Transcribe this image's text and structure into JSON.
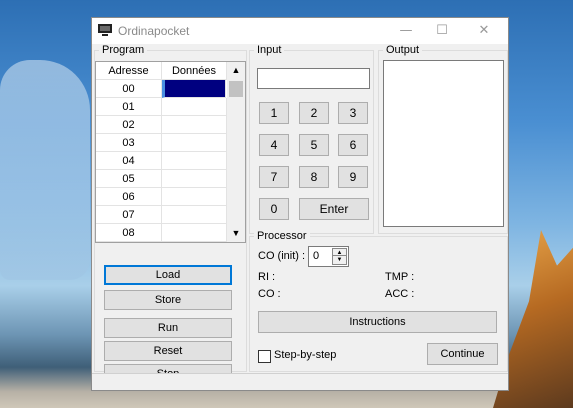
{
  "window": {
    "title": "Ordinapocket",
    "controls": {
      "minimize": "—",
      "maximize": "☐",
      "close": "✕"
    }
  },
  "program": {
    "title": "Program",
    "columns": [
      "Adresse",
      "Données"
    ],
    "rows": [
      {
        "addr": "00",
        "data": ""
      },
      {
        "addr": "01",
        "data": ""
      },
      {
        "addr": "02",
        "data": ""
      },
      {
        "addr": "03",
        "data": ""
      },
      {
        "addr": "04",
        "data": ""
      },
      {
        "addr": "05",
        "data": ""
      },
      {
        "addr": "06",
        "data": ""
      },
      {
        "addr": "07",
        "data": ""
      },
      {
        "addr": "08",
        "data": ""
      }
    ],
    "selected_color": "#000080"
  },
  "actions": {
    "load": "Load",
    "store": "Store",
    "run": "Run",
    "reset": "Reset",
    "stop": "Stop"
  },
  "input": {
    "title": "Input",
    "value": "",
    "keys": [
      "1",
      "2",
      "3",
      "4",
      "5",
      "6",
      "7",
      "8",
      "9",
      "0"
    ],
    "enter": "Enter"
  },
  "output": {
    "title": "Output",
    "value": ""
  },
  "processor": {
    "title": "Processor",
    "co_init_label": "CO (init) :",
    "co_init_value": "0",
    "ri_label": "RI :",
    "tmp_label": "TMP :",
    "co_label": "CO :",
    "acc_label": "ACC :",
    "instructions": "Instructions",
    "step_by_step": "Step-by-step",
    "continue": "Continue"
  },
  "colors": {
    "focus": "#0078d7",
    "selection": "#000080"
  }
}
